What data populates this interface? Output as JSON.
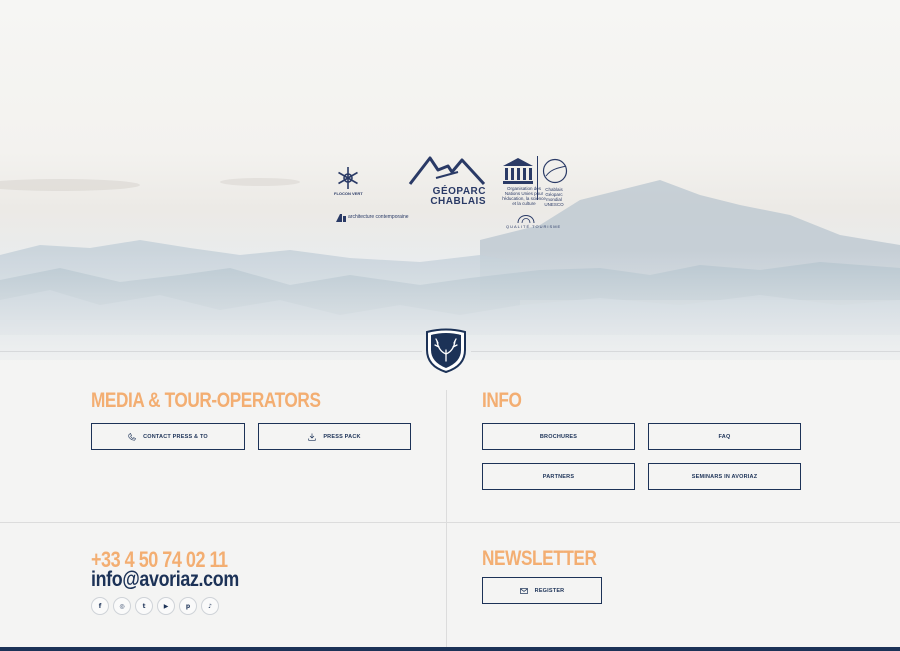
{
  "logos": {
    "flocon_vert": "FLOCON VERT",
    "architecture": "architecture contemporaine",
    "geoparc": [
      "GÉOPARC",
      "CHABLAIS"
    ],
    "unesco_org": "Organisation des Nations Unies pour l'éducation, la science et la culture",
    "chablais_geoparc": "Chablais Géoparc mondial UNESCO",
    "qualite_tourisme": "QUALITÉ TOURISME"
  },
  "media": {
    "heading": "MEDIA & TOUR-OPERATORS",
    "contact_label": "CONTACT PRESS & TO",
    "press_label": "PRESS PACK"
  },
  "info": {
    "heading": "INFO",
    "brochures_label": "BROCHURES",
    "faq_label": "FAQ",
    "partners_label": "PARTNERS",
    "seminars_label": "SEMINARS IN AVORIAZ"
  },
  "contact": {
    "phone": "+33 4 50 74 02 11",
    "email": "info@avoriaz.com"
  },
  "socials": [
    {
      "name": "facebook-icon",
      "glyph": "f"
    },
    {
      "name": "instagram-icon",
      "glyph": "◎"
    },
    {
      "name": "twitter-icon",
      "glyph": "t"
    },
    {
      "name": "youtube-icon",
      "glyph": "▶"
    },
    {
      "name": "pinterest-icon",
      "glyph": "p"
    },
    {
      "name": "tiktok-icon",
      "glyph": "♪"
    }
  ],
  "newsletter": {
    "heading": "NEWSLETTER",
    "register_label": "REGISTER"
  },
  "colors": {
    "accent": "#f3ae72",
    "navy": "#1c3257"
  }
}
